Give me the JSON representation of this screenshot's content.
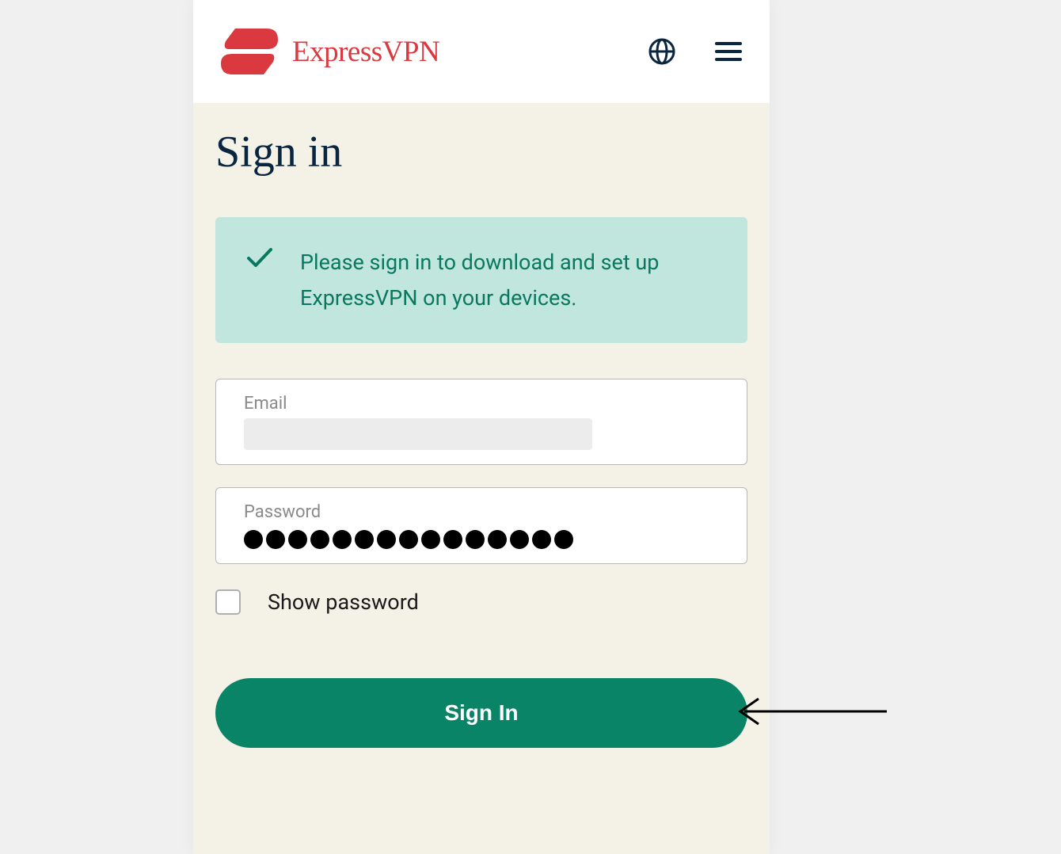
{
  "header": {
    "brand_name": "ExpressVPN"
  },
  "page": {
    "title": "Sign in"
  },
  "notice": {
    "message": "Please sign in to download and set up ExpressVPN on your devices."
  },
  "form": {
    "email_label": "Email",
    "email_value": "",
    "password_label": "Password",
    "password_dot_count": 15,
    "show_password_label": "Show password",
    "show_password_checked": false,
    "submit_label": "Sign In"
  },
  "colors": {
    "brand_red": "#da3940",
    "brand_green": "#0a8466",
    "notice_bg": "#c1e6dd",
    "notice_text": "#0a7860",
    "dark_navy": "#0a2540",
    "content_bg": "#f4f1e6"
  }
}
